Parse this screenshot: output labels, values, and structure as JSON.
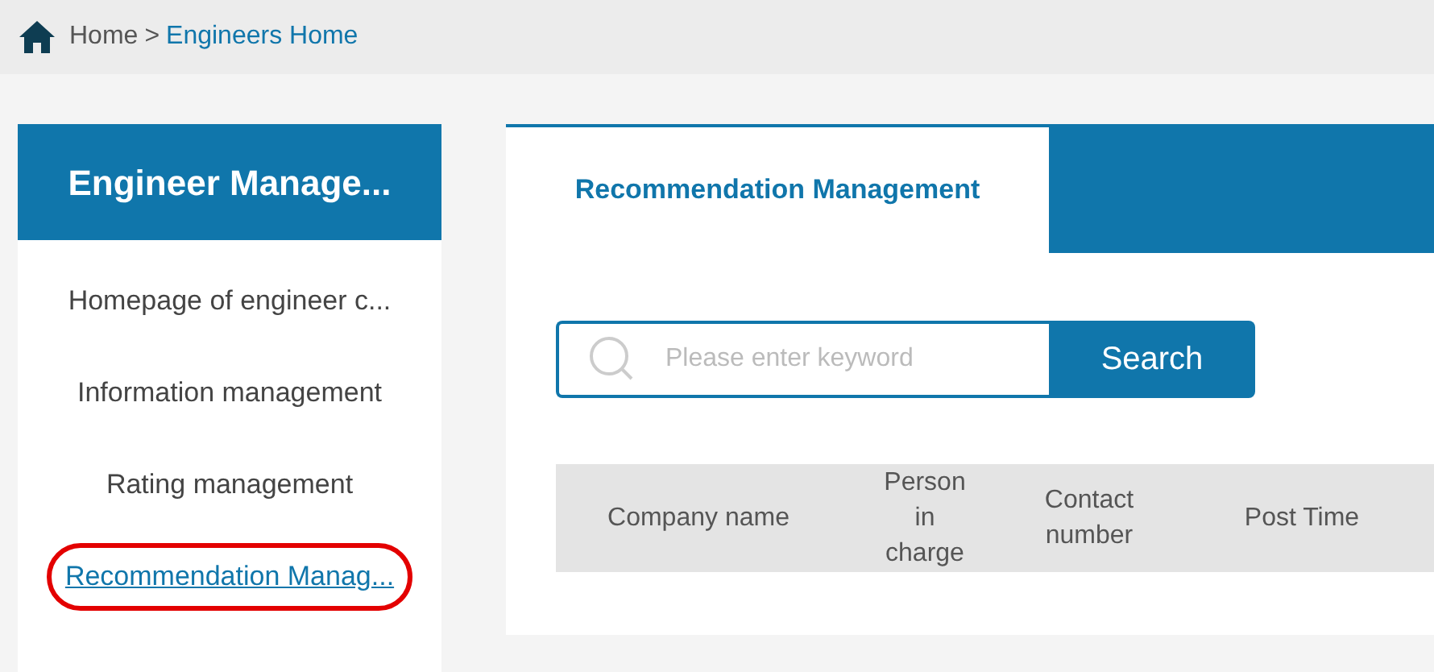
{
  "breadcrumb": {
    "home": "Home",
    "separator": ">",
    "current": "Engineers Home"
  },
  "sidebar": {
    "title": "Engineer Manage...",
    "items": [
      {
        "label": "Homepage of engineer c...",
        "selected": false
      },
      {
        "label": "Information management",
        "selected": false
      },
      {
        "label": "Rating management",
        "selected": false
      },
      {
        "label": "Recommendation Manag...",
        "selected": true
      }
    ]
  },
  "tabs": [
    {
      "label": "Recommendation Management",
      "selected": true
    }
  ],
  "search": {
    "placeholder": "Please enter keyword",
    "button": "Search"
  },
  "table": {
    "columns": [
      "Company name",
      "Person in charge",
      "Contact number",
      "Post Time"
    ]
  }
}
